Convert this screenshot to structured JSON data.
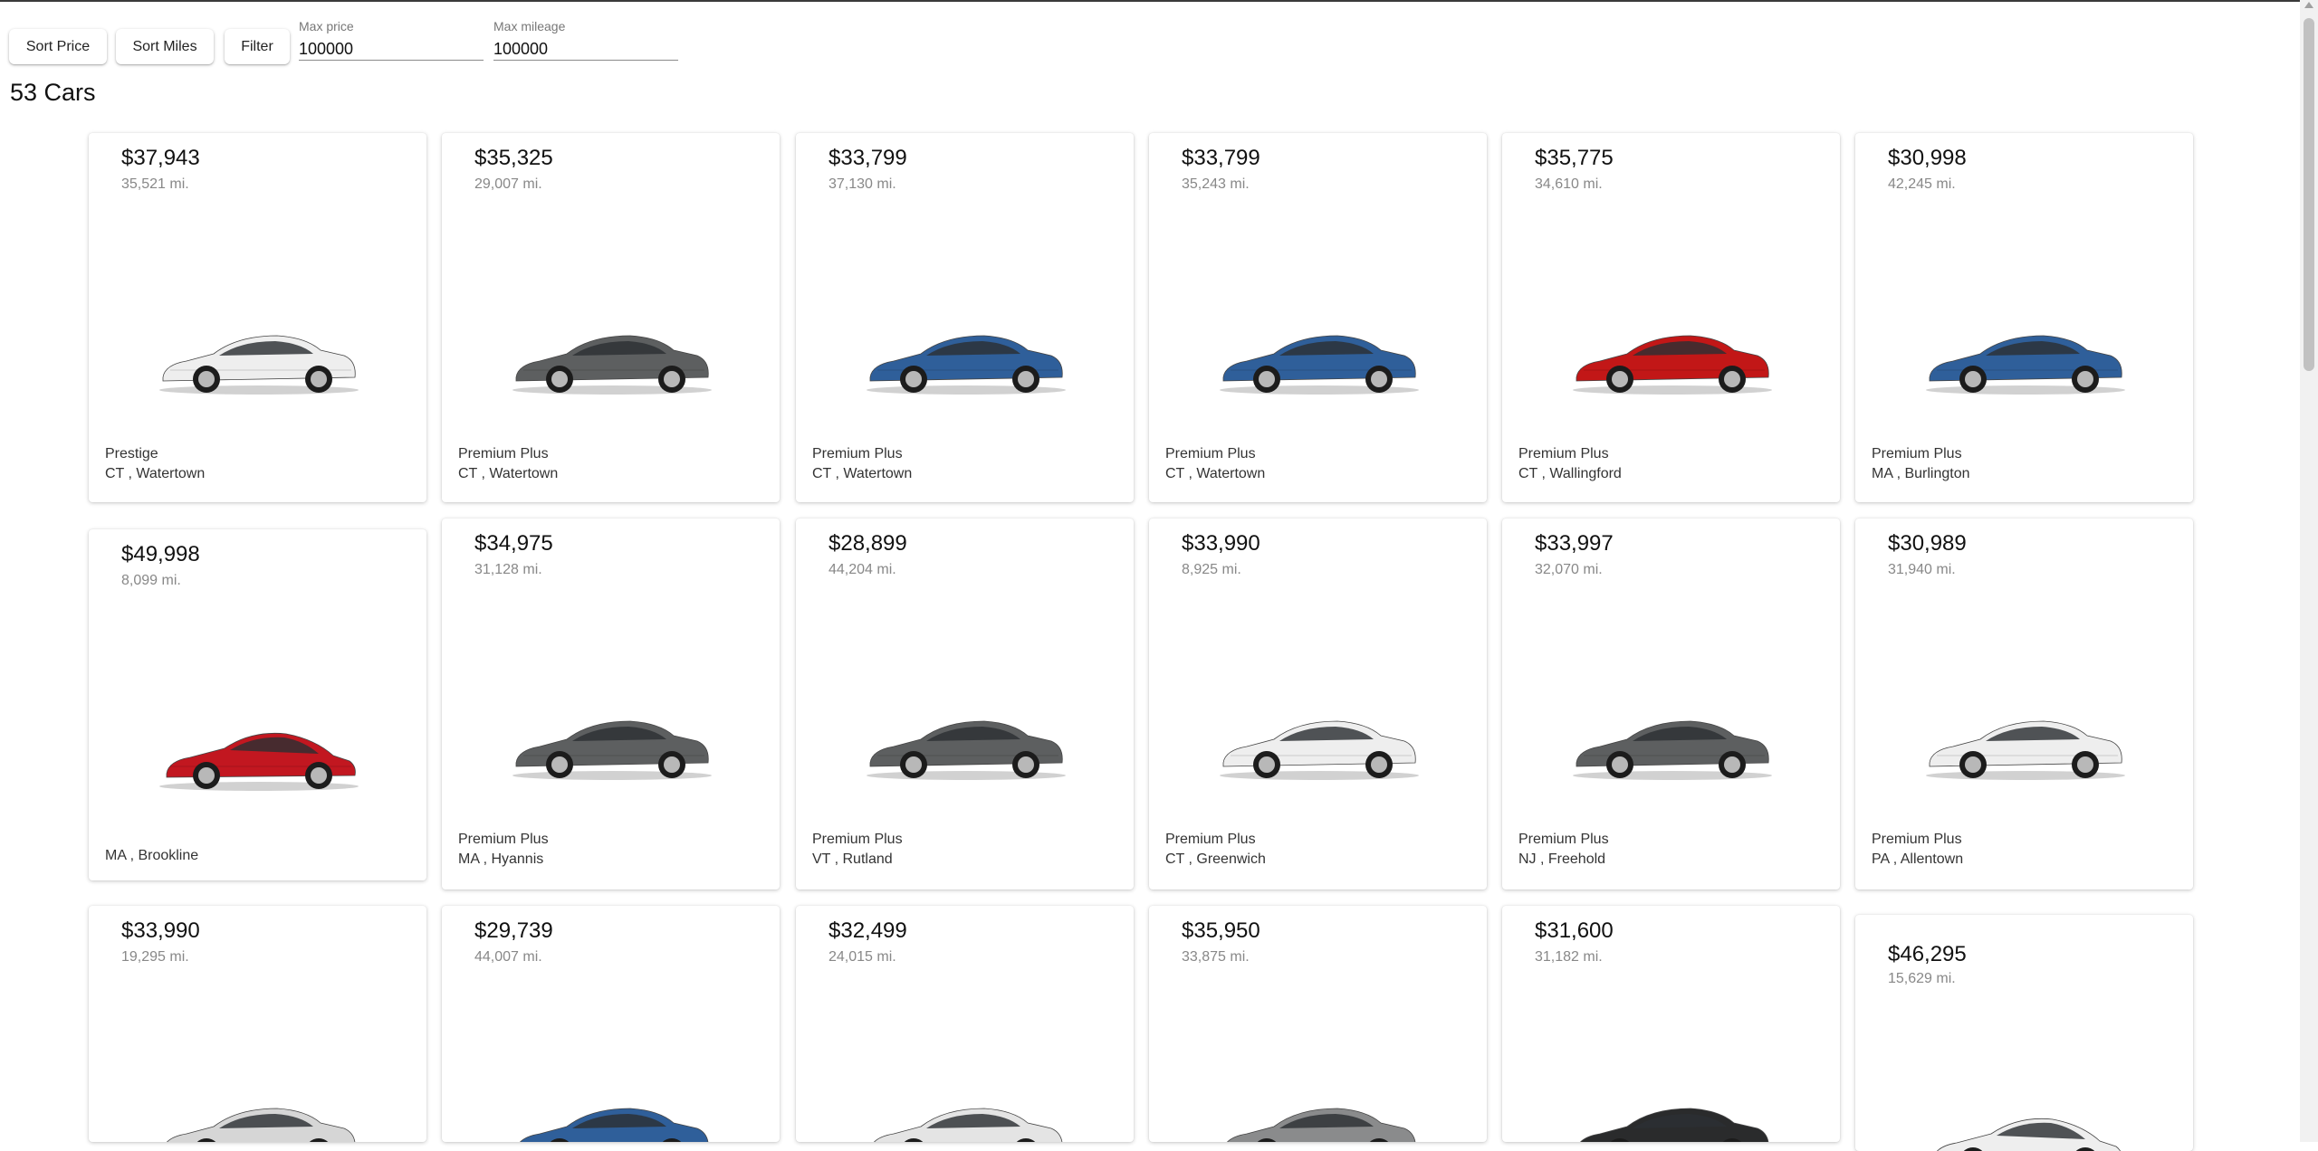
{
  "toolbar": {
    "sort_price": "Sort Price",
    "sort_miles": "Sort Miles",
    "filter": "Filter",
    "max_price_label": "Max price",
    "max_price_value": "100000",
    "max_mileage_label": "Max mileage",
    "max_mileage_value": "100000"
  },
  "count_text": "53 Cars",
  "cars": [
    {
      "price": "$37,943",
      "miles": "35,521 mi.",
      "trim": "Prestige",
      "location": "CT , Watertown",
      "color": "#eeeeee",
      "body": "sedan"
    },
    {
      "price": "$35,325",
      "miles": "29,007 mi.",
      "trim": "Premium Plus",
      "location": "CT , Watertown",
      "color": "#5d5f60",
      "body": "sedan"
    },
    {
      "price": "$33,799",
      "miles": "37,130 mi.",
      "trim": "Premium Plus",
      "location": "CT , Watertown",
      "color": "#2f5f9a",
      "body": "sedan"
    },
    {
      "price": "$33,799",
      "miles": "35,243 mi.",
      "trim": "Premium Plus",
      "location": "CT , Watertown",
      "color": "#2f5f9a",
      "body": "sedan"
    },
    {
      "price": "$35,775",
      "miles": "34,610 mi.",
      "trim": "Premium Plus",
      "location": "CT , Wallingford",
      "color": "#c21717",
      "body": "sedan"
    },
    {
      "price": "$30,998",
      "miles": "42,245 mi.",
      "trim": "Premium Plus",
      "location": "MA , Burlington",
      "color": "#2f5f9a",
      "body": "sedan"
    },
    {
      "price": "$49,998",
      "miles": "8,099 mi.",
      "trim": "",
      "location": "MA , Brookline",
      "color": "#c21720",
      "body": "coupe"
    },
    {
      "price": "$34,975",
      "miles": "31,128 mi.",
      "trim": "Premium Plus",
      "location": "MA , Hyannis",
      "color": "#5d5f60",
      "body": "sedan"
    },
    {
      "price": "$28,899",
      "miles": "44,204 mi.",
      "trim": "Premium Plus",
      "location": "VT , Rutland",
      "color": "#5d5f60",
      "body": "sedan"
    },
    {
      "price": "$33,990",
      "miles": "8,925 mi.",
      "trim": "Premium Plus",
      "location": "CT , Greenwich",
      "color": "#eeeeee",
      "body": "sedan"
    },
    {
      "price": "$33,997",
      "miles": "32,070 mi.",
      "trim": "Premium Plus",
      "location": "NJ , Freehold",
      "color": "#5d5f60",
      "body": "sedan"
    },
    {
      "price": "$30,989",
      "miles": "31,940 mi.",
      "trim": "Premium Plus",
      "location": "PA , Allentown",
      "color": "#eeeeee",
      "body": "sedan"
    },
    {
      "price": "$33,990",
      "miles": "19,295 mi.",
      "trim": "",
      "location": "",
      "color": "#d6d6d6",
      "body": "sedan"
    },
    {
      "price": "$29,739",
      "miles": "44,007 mi.",
      "trim": "",
      "location": "",
      "color": "#2f5f9a",
      "body": "sedan"
    },
    {
      "price": "$32,499",
      "miles": "24,015 mi.",
      "trim": "",
      "location": "",
      "color": "#e4e4e4",
      "body": "sedan"
    },
    {
      "price": "$35,950",
      "miles": "33,875 mi.",
      "trim": "",
      "location": "",
      "color": "#8a8b8c",
      "body": "sedan"
    },
    {
      "price": "$31,600",
      "miles": "31,182 mi.",
      "trim": "",
      "location": "",
      "color": "#2a2b2c",
      "body": "sedan"
    },
    {
      "price": "$46,295",
      "miles": "15,629 mi.",
      "trim": "",
      "location": "",
      "color": "#eeeeee",
      "body": "coupe"
    }
  ]
}
